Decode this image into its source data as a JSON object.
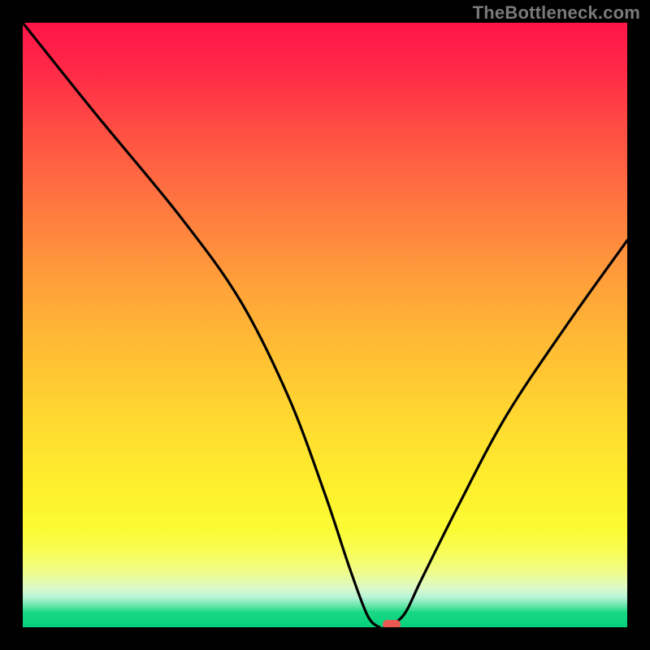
{
  "watermark": "TheBottleneck.com",
  "chart_data": {
    "type": "line",
    "title": "",
    "xlabel": "",
    "ylabel": "",
    "xlim": [
      0,
      100
    ],
    "ylim": [
      0,
      100
    ],
    "grid": false,
    "legend": false,
    "background": "red-to-green vertical gradient (bottleneck heatmap)",
    "series": [
      {
        "name": "bottleneck-curve",
        "x": [
          0,
          12,
          26,
          36,
          44,
          50,
          54,
          57,
          59,
          60,
          63,
          66,
          72,
          80,
          90,
          100
        ],
        "values": [
          100,
          85,
          68,
          54,
          38,
          22,
          10,
          2,
          0,
          0,
          2,
          8,
          20,
          35,
          50,
          64
        ]
      }
    ],
    "marker": {
      "x": 61,
      "y": 0.5,
      "color": "#ea5a53",
      "shape": "rounded-rect"
    }
  },
  "colors": {
    "frame": "#000000",
    "watermark": "#7a7a7a",
    "curve": "#000000",
    "marker": "#ea5a53"
  }
}
